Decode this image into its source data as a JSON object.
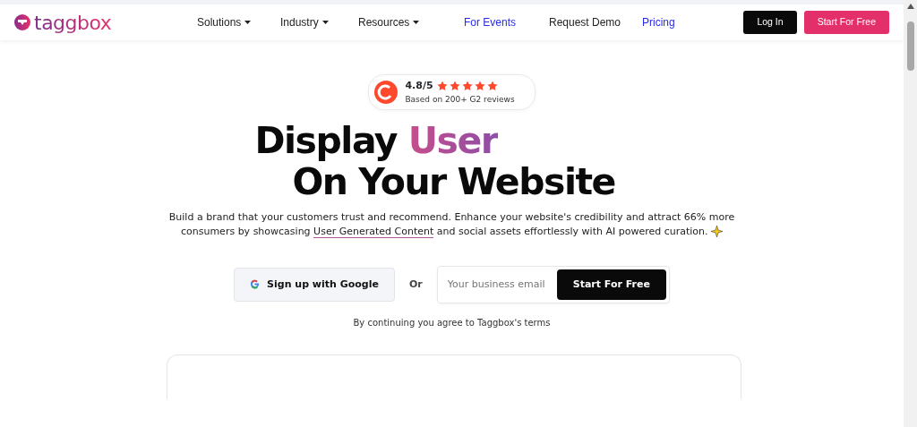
{
  "logo": {
    "text": "taggbox"
  },
  "nav": [
    {
      "label": "Solutions",
      "dropdown": true,
      "highlight": false
    },
    {
      "label": "Industry",
      "dropdown": true,
      "highlight": false
    },
    {
      "label": "Resources",
      "dropdown": true,
      "highlight": false
    },
    {
      "label": "For Events",
      "dropdown": false,
      "highlight": true
    },
    {
      "label": "Request Demo",
      "dropdown": false,
      "highlight": false
    },
    {
      "label": "Pricing",
      "dropdown": false,
      "highlight": true
    }
  ],
  "login": "Log In",
  "cta": "Start For Free",
  "rating": {
    "score": "4.8/5",
    "stars": 5,
    "caption": "Based on 200+ G2 reviews"
  },
  "headline": {
    "line1": "Display",
    "accent": "User",
    "line2": "On Your Website"
  },
  "intro": {
    "before": "Build a brand that your customers trust and recommend. Enhance your website's credibility and attract 66% more consumers by showcasing",
    "link": "User Generated Content",
    "after": "and social assets effortlessly with AI powered curation."
  },
  "google_button": "Sign up with Google",
  "or": "Or",
  "email": {
    "placeholder": "Your business email"
  },
  "submit": "Start For Free",
  "terms": "By continuing you agree to Taggbox's terms"
}
